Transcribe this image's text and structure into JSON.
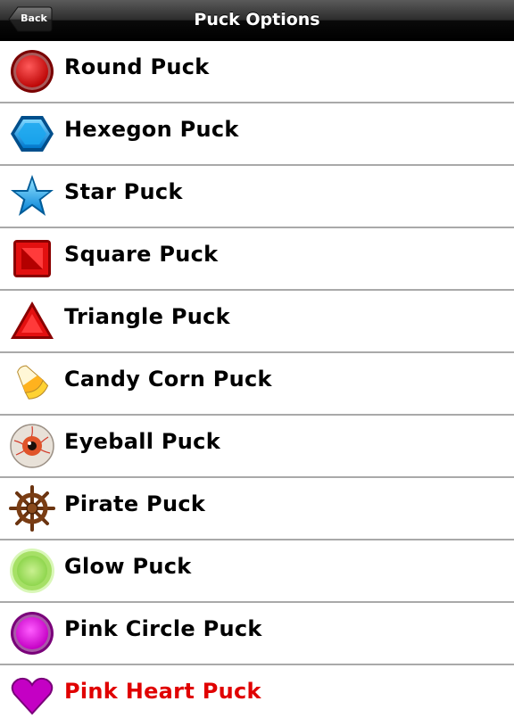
{
  "navbar": {
    "title": "Puck Options",
    "back_label": "Back"
  },
  "pucks": [
    {
      "label": "Round Puck",
      "icon": "round-puck-icon"
    },
    {
      "label": "Hexegon Puck",
      "icon": "hexagon-puck-icon"
    },
    {
      "label": "Star Puck",
      "icon": "star-puck-icon"
    },
    {
      "label": "Square Puck",
      "icon": "square-puck-icon"
    },
    {
      "label": "Triangle Puck",
      "icon": "triangle-puck-icon"
    },
    {
      "label": "Candy Corn Puck",
      "icon": "candy-corn-puck-icon"
    },
    {
      "label": "Eyeball Puck",
      "icon": "eyeball-puck-icon"
    },
    {
      "label": "Pirate Puck",
      "icon": "pirate-wheel-puck-icon"
    },
    {
      "label": "Glow Puck",
      "icon": "glow-puck-icon"
    },
    {
      "label": "Pink Circle Puck",
      "icon": "pink-circle-puck-icon"
    },
    {
      "label": "Pink Heart Puck",
      "icon": "pink-heart-puck-icon"
    }
  ],
  "colors": {
    "navbar": "#000000",
    "separator": "#a9a9a9",
    "selected_label": "#e00000"
  }
}
